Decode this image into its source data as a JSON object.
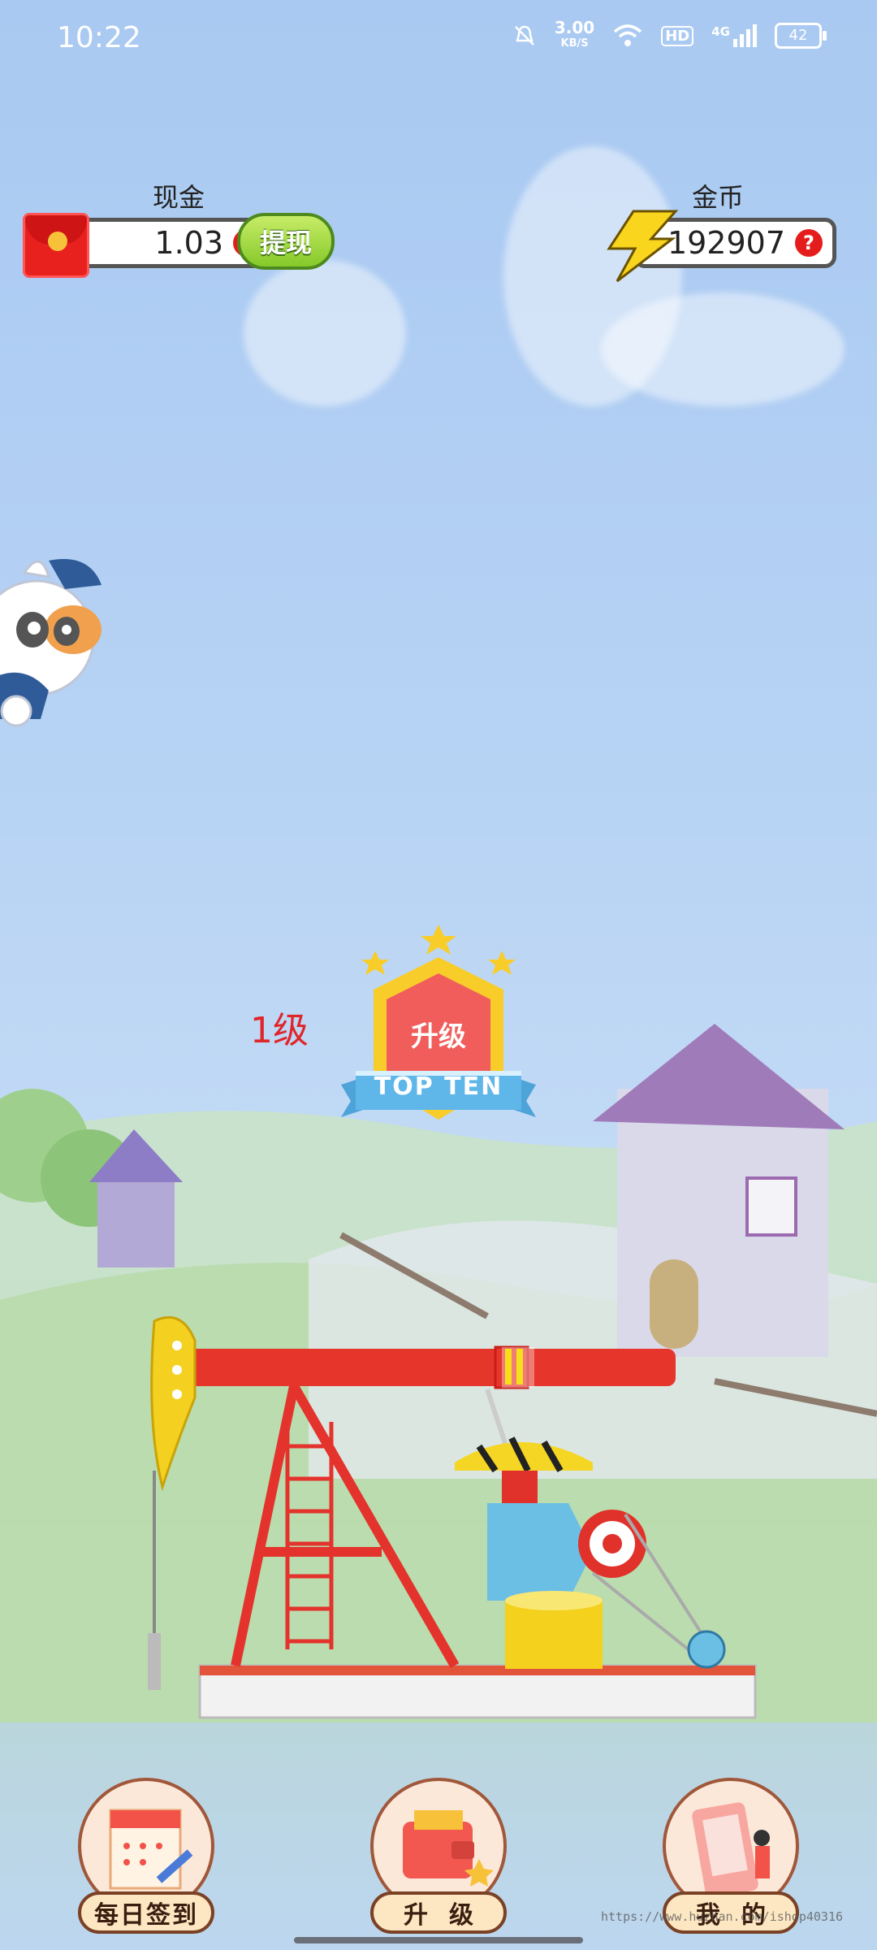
{
  "status_bar": {
    "time": "10:22",
    "speed_value": "3.00",
    "speed_unit": "KB/S",
    "hd": "HD",
    "network": "4G",
    "battery": "42"
  },
  "cash": {
    "label": "现金",
    "value": "1.03",
    "help": "?",
    "withdraw_label": "提现"
  },
  "coins": {
    "label": "金币",
    "value": "192907",
    "help": "?"
  },
  "level": {
    "text": "1级",
    "upgrade_badge_label": "升级",
    "ribbon_text": "TOP TEN"
  },
  "bottom_nav": {
    "checkin_label": "每日签到",
    "upgrade_label": "升级",
    "mine_label": "我的"
  },
  "watermark": "https://www.huzhan.com/ishop40316",
  "colors": {
    "accent_red": "#e51c1c",
    "withdraw_green": "#86c92a",
    "level_text": "#e0252a"
  }
}
